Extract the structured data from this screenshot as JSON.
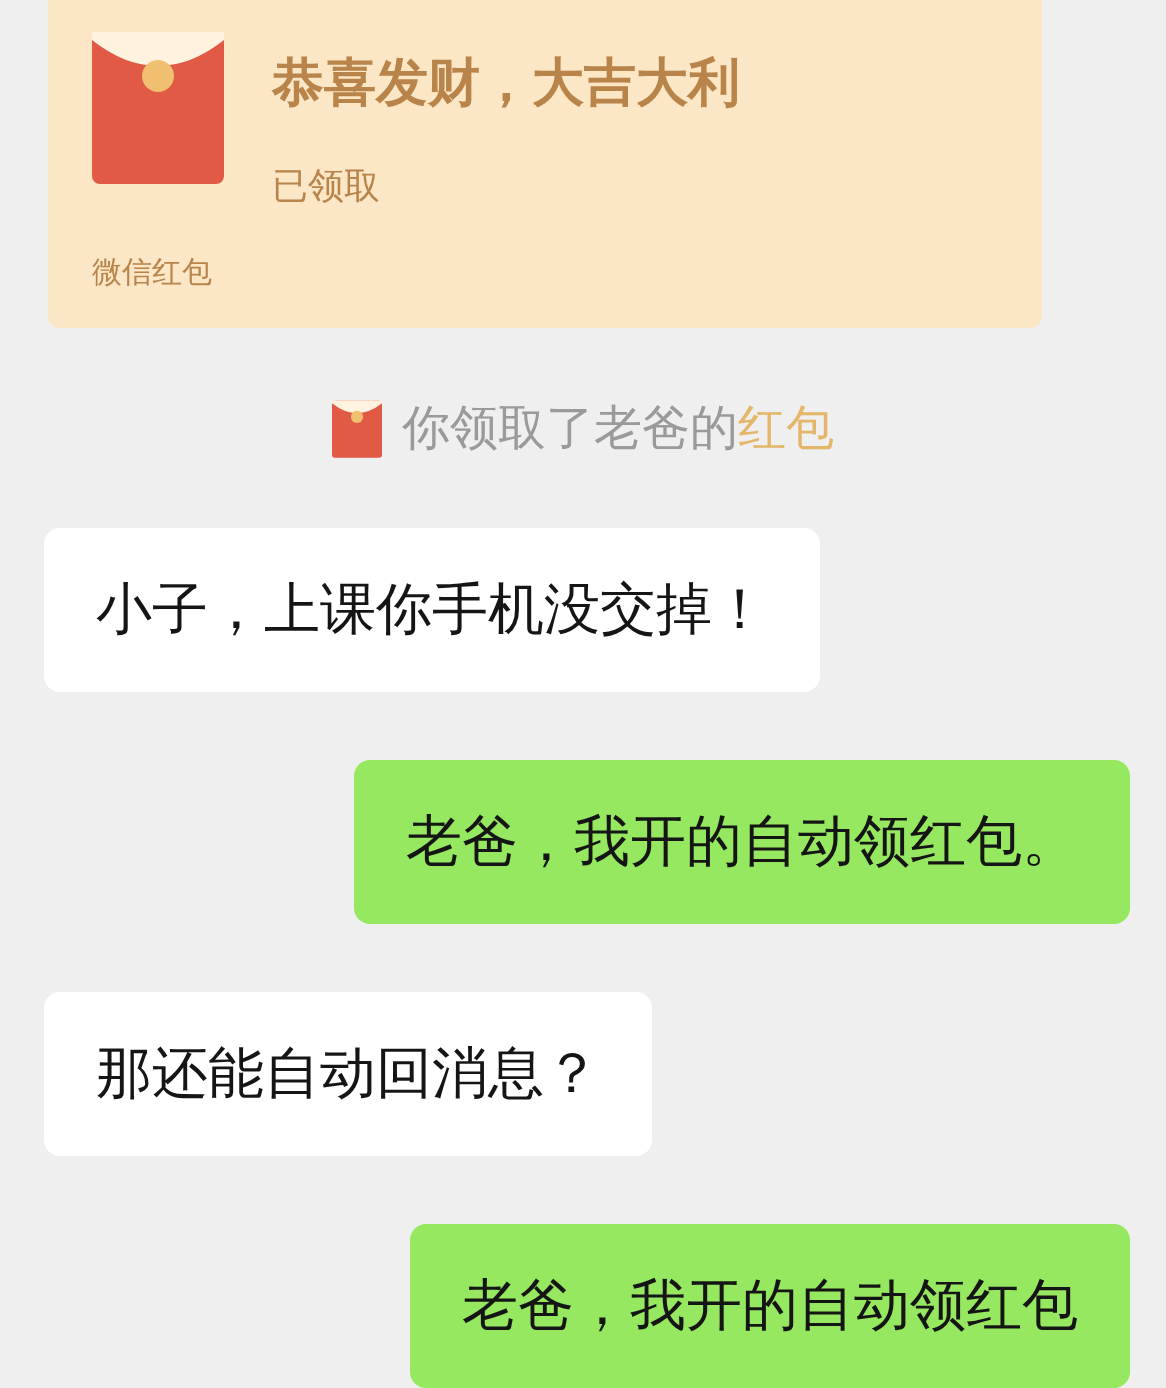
{
  "red_packet": {
    "greeting": "恭喜发财，大吉大利",
    "status": "已领取",
    "footer": "微信红包"
  },
  "notice": {
    "text": "你领取了老爸的",
    "link": "红包"
  },
  "messages": [
    {
      "kind": "received",
      "text": "小子，上课你手机没交掉！"
    },
    {
      "kind": "sent",
      "text": "老爸，我开的自动领红包。"
    },
    {
      "kind": "received",
      "text": "那还能自动回消息？"
    },
    {
      "kind": "sent",
      "text": "老爸，我开的自动领红包"
    }
  ]
}
